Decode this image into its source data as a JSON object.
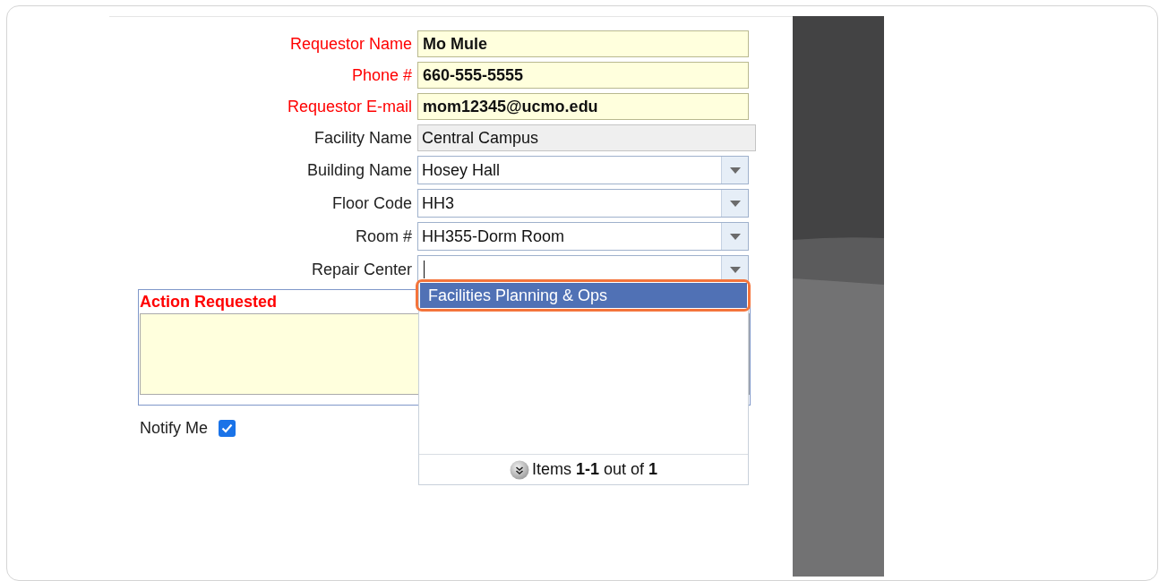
{
  "fields": [
    {
      "label": "Requestor Name",
      "required": true,
      "kind": "text",
      "value": "Mo Mule",
      "focused": false
    },
    {
      "label": "Phone #",
      "required": true,
      "kind": "text",
      "value": "660-555-5555",
      "focused": false
    },
    {
      "label": "Requestor E-mail",
      "required": true,
      "kind": "text",
      "value": "mom12345@ucmo.edu",
      "focused": false
    },
    {
      "label": "Facility Name",
      "required": false,
      "kind": "readonly",
      "value": "Central Campus",
      "focused": false
    },
    {
      "label": "Building Name",
      "required": false,
      "kind": "combo",
      "value": "Hosey Hall",
      "focused": false
    },
    {
      "label": "Floor Code",
      "required": false,
      "kind": "combo",
      "value": "HH3",
      "focused": false
    },
    {
      "label": "Room #",
      "required": false,
      "kind": "combo",
      "value": "HH355-Dorm Room",
      "focused": false
    },
    {
      "label": "Repair Center",
      "required": false,
      "kind": "combo",
      "focused": true
    }
  ],
  "action": {
    "label": "Action Requested",
    "required": true
  },
  "notify": {
    "label": "Notify Me",
    "checked": true
  },
  "dropdown": {
    "items": [
      {
        "label": "Facilities Planning & Ops",
        "selected": true,
        "highlighted": true
      }
    ],
    "footer": "Items **1-1** out of **1**"
  }
}
